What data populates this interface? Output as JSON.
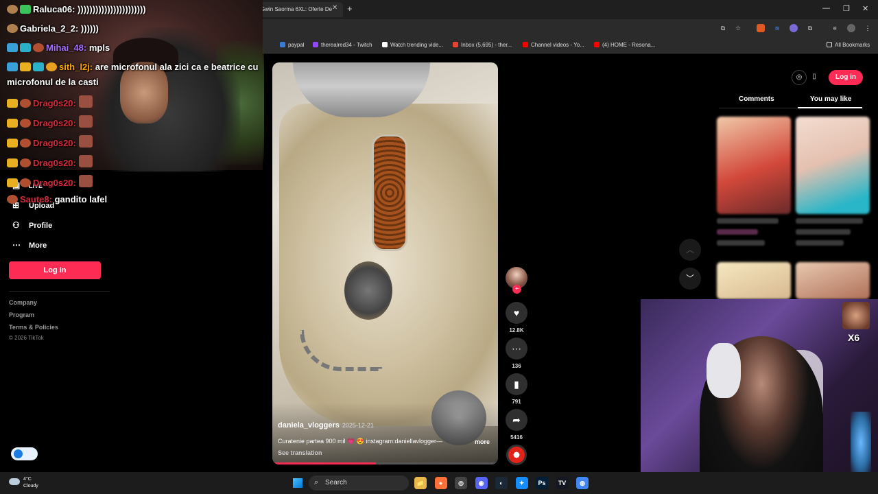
{
  "browser": {
    "tab_title": "Gwin Saorma 6XL: Oferte De",
    "new_tab": "+",
    "bookmarks": [
      {
        "label": "paypal",
        "color": "#3b7bd4"
      },
      {
        "label": "therealred34 - Twitch",
        "color": "#9146ff"
      },
      {
        "label": "Watch trending vide...",
        "color": "#ffffff"
      },
      {
        "label": "Inbox (5,695) - ther...",
        "color": "#ea4335"
      },
      {
        "label": "Channel videos - Yo...",
        "color": "#ff0000"
      },
      {
        "label": "(4) HOME - Resona...",
        "color": "#ff0000"
      }
    ],
    "all_bookmarks": "All Bookmarks"
  },
  "sidebar": {
    "items": [
      {
        "label": "LIVE",
        "icon": "live-icon"
      },
      {
        "label": "Upload",
        "icon": "upload-icon"
      },
      {
        "label": "Profile",
        "icon": "profile-icon"
      },
      {
        "label": "More",
        "icon": "more-icon"
      }
    ],
    "login": "Log in",
    "footer": [
      "Company",
      "Program",
      "Terms & Policies"
    ],
    "copyright": "© 2026 TikTok"
  },
  "video": {
    "author": "daniela_vloggers",
    "date": "2025-12-21",
    "caption": "Curatenie partea 900 mil 💗 😍 instagram:daniellavlogger—",
    "more": "more",
    "translate": "See translation",
    "progress": 0.46
  },
  "actions": {
    "likes": "12.8K",
    "comments": "136",
    "saves": "791",
    "shares": "5416"
  },
  "right_panel": {
    "login": "Log in",
    "tabs": [
      "Comments",
      "You may like"
    ],
    "active_tab": "You may like"
  },
  "chat": [
    {
      "name": "Raluca06:",
      "text": ")))))))))))))))))))))))",
      "color": "#ffffff"
    },
    {
      "name": "Gabriela_2_2:",
      "text": ")))))) ",
      "color": "#ffffff"
    },
    {
      "name": "Mihai_48:",
      "text": "mpls",
      "color": "#a970ff"
    },
    {
      "name": "sith_l2j:",
      "text": "are microfonul ala zici ca e beatrice cu",
      "color": "#ffa500"
    },
    {
      "name": "",
      "text": "microfonul de la casti",
      "color": "#ffffff"
    },
    {
      "name": "Drag0s20:",
      "text": "",
      "color": "#d42a3a"
    },
    {
      "name": "Drag0s20:",
      "text": "",
      "color": "#d42a3a"
    },
    {
      "name": "Drag0s20:",
      "text": "",
      "color": "#d42a3a"
    },
    {
      "name": "Drag0s20:",
      "text": "",
      "color": "#d42a3a"
    },
    {
      "name": "Drag0s20:",
      "text": "",
      "color": "#d42a3a"
    },
    {
      "name": "Saute8:",
      "text": "gandito lafel",
      "color": "#d42a3a"
    }
  ],
  "emote_counter": "X6",
  "taskbar": {
    "temp": "4°C",
    "weather": "Cloudy",
    "search": "Search",
    "apps": [
      {
        "name": "files-app-icon",
        "glyph": "📁",
        "color": "#e8b84a"
      },
      {
        "name": "firefox-app-icon",
        "glyph": "●",
        "color": "#ff7139"
      },
      {
        "name": "obs-app-icon",
        "glyph": "◎",
        "color": "#444444"
      },
      {
        "name": "discord-app-icon",
        "glyph": "◉",
        "color": "#5865f2"
      },
      {
        "name": "steam-app-icon",
        "glyph": "◐",
        "color": "#1b2838"
      },
      {
        "name": "battlenet-app-icon",
        "glyph": "✦",
        "color": "#148eff"
      },
      {
        "name": "photoshop-app-icon",
        "glyph": "Ps",
        "color": "#001e36"
      },
      {
        "name": "tradingview-app-icon",
        "glyph": "TV",
        "color": "#131722"
      },
      {
        "name": "chrome-app-icon",
        "glyph": "◍",
        "color": "#4285f4"
      }
    ]
  }
}
